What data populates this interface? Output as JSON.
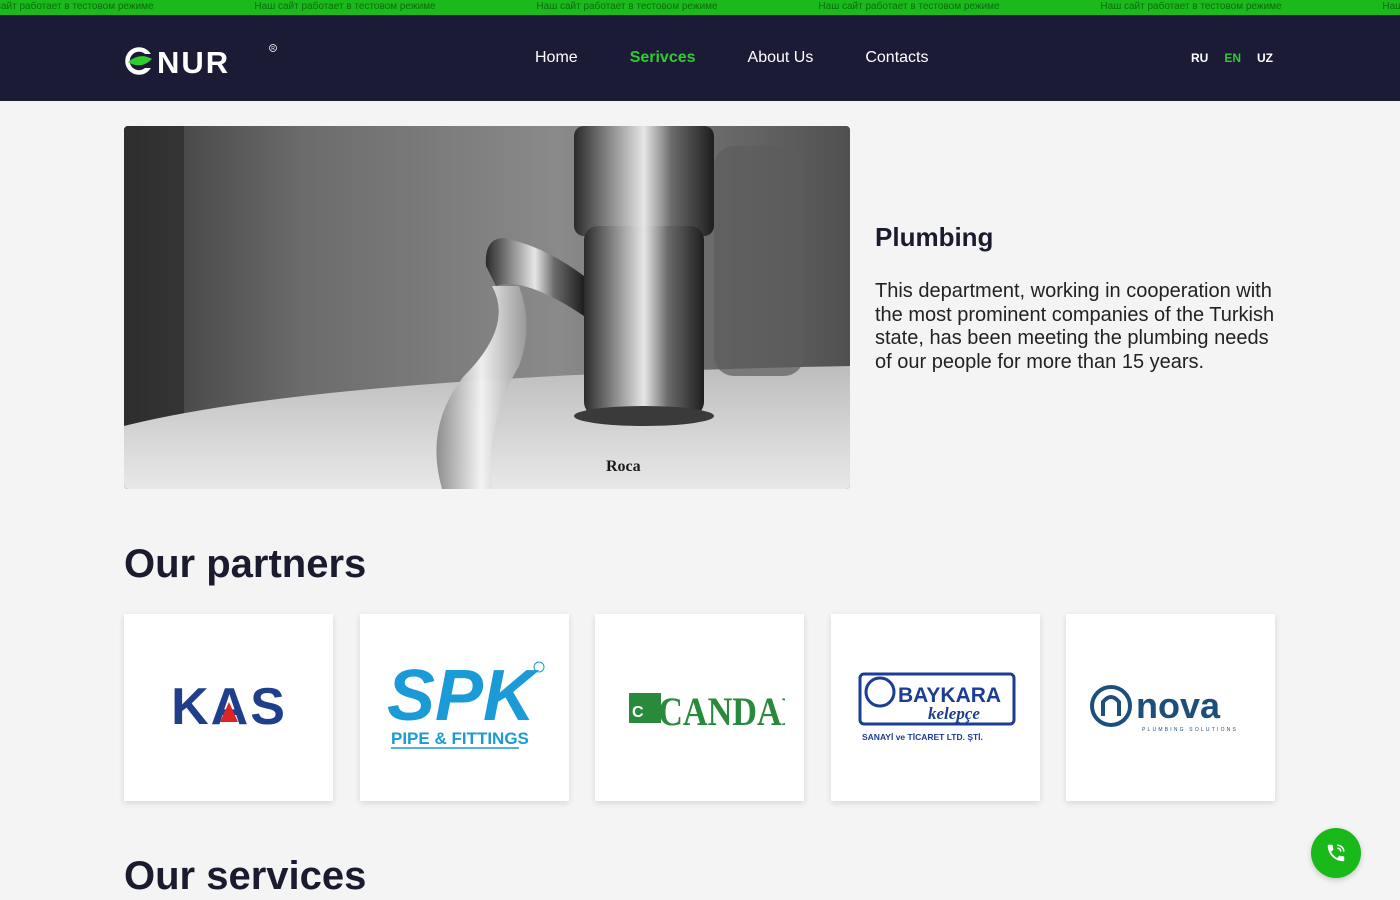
{
  "ticker": {
    "message": "Наш сайт работает в тестовом режиме",
    "items": [
      "Наш сайт работает в тестовом режиме",
      "Наш сайт работает в тестовом режиме",
      "Наш сайт работает в тестовом режиме",
      "Наш сайт работает в тестовом режиме",
      "Наш сайт работает в тестовом режиме",
      "Наш сайт работает в тестовом режиме"
    ]
  },
  "header": {
    "logo_text": "ONUR",
    "nav": [
      {
        "label": "Home",
        "active": false
      },
      {
        "label": "Serivces",
        "active": true
      },
      {
        "label": "About Us",
        "active": false
      },
      {
        "label": "Contacts",
        "active": false
      }
    ],
    "languages": [
      {
        "label": "RU",
        "active": false
      },
      {
        "label": "EN",
        "active": true
      },
      {
        "label": "UZ",
        "active": false
      }
    ]
  },
  "hero": {
    "image_brand_text": "Roca",
    "title": "Plumbing",
    "description": "This department, working in cooperation with the most prominent companies of the Turkish state, has been meeting the plumbing needs of our people for more than 15 years."
  },
  "partners": {
    "title": "Our partners",
    "items": [
      {
        "name": "KAS"
      },
      {
        "name": "SPK",
        "sub": "PIPE & FITTINGS"
      },
      {
        "name": "CANDAN"
      },
      {
        "name": "BAYKARA",
        "sub": "kelepçe",
        "sub2": "SANAYİ ve TİCARET LTD. ŞTİ."
      },
      {
        "name": "nova",
        "sub": "PLUMBING SOLUTIONS"
      }
    ]
  },
  "services": {
    "title": "Our services"
  },
  "colors": {
    "accent": "#1bb91b",
    "header_bg": "#1c1b36",
    "page_bg": "#f4f4f4",
    "active_nav": "#2ecc2e"
  },
  "icons": {
    "call_button": "phone-icon"
  }
}
